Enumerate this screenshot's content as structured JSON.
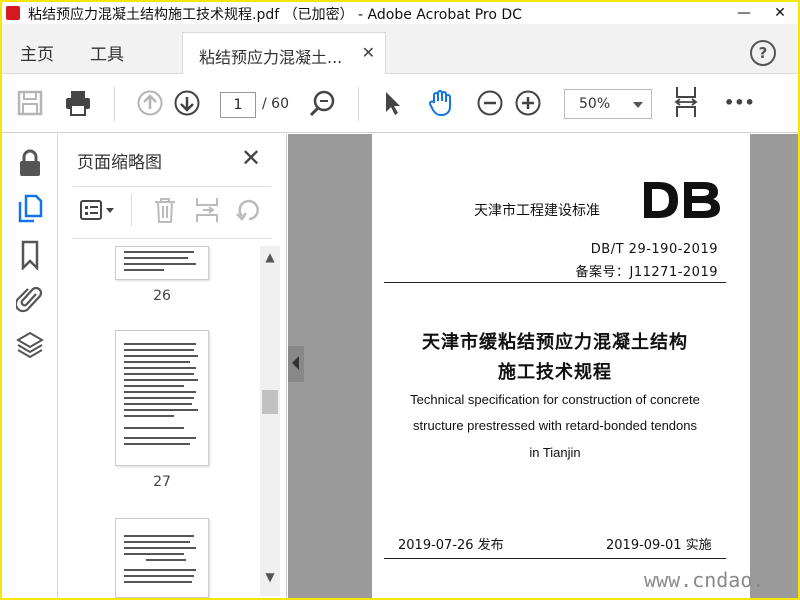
{
  "window": {
    "title": "粘结预应力混凝土结构施工技术规程.pdf （已加密） - Adobe Acrobat Pro DC",
    "minimize": "—",
    "close": "✕"
  },
  "menu": {
    "home": "主页",
    "tools": "工具",
    "tab_label": "粘结预应力混凝土...",
    "tab_close": "✕",
    "help": "?"
  },
  "toolbar": {
    "current_page": "1",
    "total_pages": "/ 60",
    "zoom": "50%",
    "more": "•••"
  },
  "panel": {
    "title": "页面缩略图",
    "close": "✕",
    "thumbs": [
      {
        "label": "26"
      },
      {
        "label": "27"
      }
    ]
  },
  "document": {
    "standard_name": "天津市工程建设标准",
    "logo": "DB",
    "code": "DB/T 29-190-2019",
    "record": "备案号：J11271-2019",
    "title_line1": "天津市缓粘结预应力混凝土结构",
    "title_line2": "施工技术规程",
    "en_line1": "Technical specification for construction of concrete",
    "en_line2": "structure prestressed with retard-bonded tendons",
    "en_line3": "in Tianjin",
    "publish_date": "2019-07-26  发布",
    "effective_date": "2019-09-01  实施"
  },
  "watermark": "www.cndao."
}
